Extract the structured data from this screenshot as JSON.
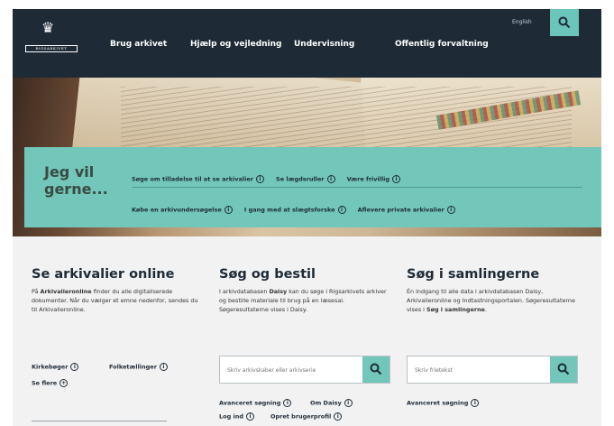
{
  "header": {
    "logo_text": "RIGSARKIVET",
    "nav": [
      "Brug arkivet",
      "Hjælp og vejledning",
      "Undervisning",
      "Offentlig forvaltning"
    ],
    "lang": "English",
    "search_icon": "search-icon"
  },
  "jeg": {
    "title": "Jeg vil gerne...",
    "row1": [
      "Søge om tilladelse til at se arkivalier",
      "Se lægdsruller",
      "Være frivillig"
    ],
    "row2": [
      "Købe en arkivundersøgelse",
      "I gang med at slægtsforske",
      "Aflevere private arkivalier"
    ]
  },
  "col1": {
    "title": "Se arkivalier online",
    "desc_pre": "På ",
    "desc_bold": "Arkivalieronline",
    "desc_post": " finder du alle digitaliserede dokumenter. Når du vælger et emne nedenfor, sendes du til Arkivalieronline.",
    "links": [
      "Kirkebøger",
      "Folketællinger",
      "Se flere"
    ]
  },
  "col2": {
    "title": "Søg og bestil",
    "desc_pre": "I arkivdatabasen ",
    "desc_bold": "Daisy",
    "desc_post": " kan du søge i Rigsarkivets arkiver og bestille materiale til brug på en læsesal. Søgeresultaterne vises i Daisy.",
    "placeholder": "Skriv arkivskaber eller arkivserie",
    "links_row1": [
      "Avanceret søgning",
      "Om Daisy"
    ],
    "links_row2": [
      "Log ind",
      "Opret brugerprofil"
    ]
  },
  "col3": {
    "title": "Søg i samlingerne",
    "desc_pre": "Én indgang til alle data i arkivdatabasen Daisy, Arkivalieronline og Indtastningsportalen. Søgeresultaterne vises i ",
    "desc_bold": "Søg i samlingerne",
    "desc_post": ".",
    "placeholder": "Skriv frietekst",
    "links": [
      "Avanceret søgning"
    ]
  },
  "info_glyph": "i",
  "more_glyph": "+",
  "colors": {
    "header": "#1e2b37",
    "accent": "#72c6ba",
    "background": "#f2f2f2"
  }
}
